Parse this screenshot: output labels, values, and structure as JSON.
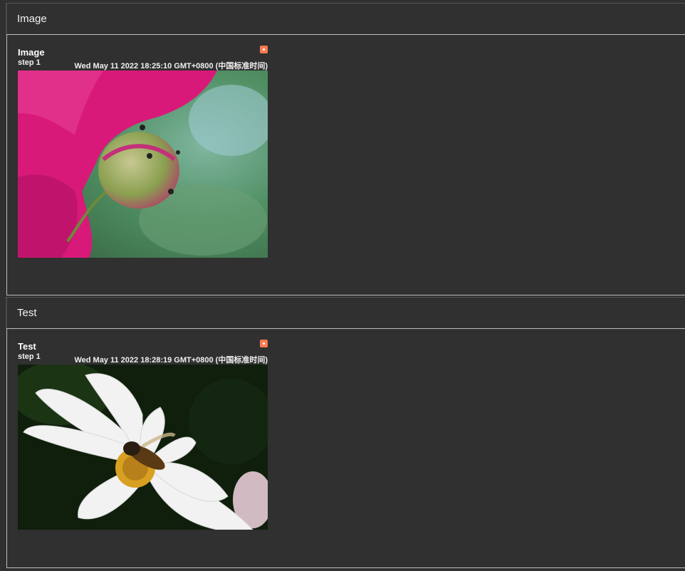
{
  "sections": [
    {
      "header": "Image",
      "card": {
        "title": "Image",
        "step": "step 1",
        "timestamp": "Wed May 11 2022 18:25:10 GMT+0800 (中国标准时间)",
        "image_subject": "pink flower and bud with ants"
      }
    },
    {
      "header": "Test",
      "card": {
        "title": "Test",
        "step": "step 1",
        "timestamp": "Wed May 11 2022 18:28:19 GMT+0800 (中国标准时间)",
        "image_subject": "white cosmos flower with bee"
      }
    }
  ],
  "colors": {
    "background": "#303030",
    "border": "#bdbdbd",
    "badge": "#ff7a50",
    "text": "#ffffff"
  }
}
